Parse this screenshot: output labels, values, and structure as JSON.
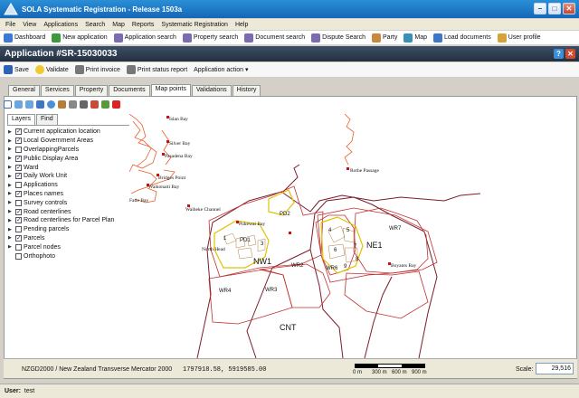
{
  "window": {
    "title": "SOLA Systematic Registration - Release 1503a"
  },
  "menu": [
    "File",
    "View",
    "Applications",
    "Search",
    "Map",
    "Reports",
    "Systematic Registration",
    "Help"
  ],
  "toolbar": {
    "items": [
      {
        "label": "Dashboard",
        "icon": "dashboard-icon",
        "color": "#3a7bd5"
      },
      {
        "label": "New application",
        "icon": "new-application-icon",
        "color": "#3c9a3c"
      },
      {
        "label": "Application search",
        "icon": "search-icon",
        "color": "#7b6bb0"
      },
      {
        "label": "Property search",
        "icon": "search-icon",
        "color": "#7b6bb0"
      },
      {
        "label": "Document search",
        "icon": "search-icon",
        "color": "#7b6bb0"
      },
      {
        "label": "Dispute Search",
        "icon": "search-icon",
        "color": "#7b6bb0"
      },
      {
        "label": "Party",
        "icon": "party-icon",
        "color": "#c9893a"
      },
      {
        "label": "Map",
        "icon": "map-icon",
        "color": "#3a8fb7"
      },
      {
        "label": "Load documents",
        "icon": "load-documents-icon",
        "color": "#3c78c9"
      },
      {
        "label": "User profile",
        "icon": "user-profile-icon",
        "color": "#d6a23a"
      }
    ]
  },
  "header": {
    "title": "Application #SR-15030033"
  },
  "actions": {
    "save": "Save",
    "validate": "Validate",
    "print_invoice": "Print invoice",
    "print_status": "Print status report",
    "app_action": "Application action"
  },
  "tabs": [
    "General",
    "Services",
    "Property",
    "Documents",
    "Map points",
    "Validations",
    "History"
  ],
  "active_tab": "Map points",
  "layer_tabs": [
    "Layers",
    "Find"
  ],
  "layers": [
    {
      "label": "Current application location",
      "checked": true,
      "expand": true
    },
    {
      "label": "Local Government Areas",
      "checked": true,
      "expand": true
    },
    {
      "label": "OverlappingParcels",
      "checked": false,
      "expand": true
    },
    {
      "label": "Public Display Area",
      "checked": true,
      "expand": true
    },
    {
      "label": "Ward",
      "checked": true,
      "expand": true
    },
    {
      "label": "Daily Work Unit",
      "checked": true,
      "expand": true
    },
    {
      "label": "Applications",
      "checked": false,
      "expand": true
    },
    {
      "label": "Places names",
      "checked": true,
      "expand": true
    },
    {
      "label": "Survey controls",
      "checked": false,
      "expand": true
    },
    {
      "label": "Road centerlines",
      "checked": true,
      "expand": true
    },
    {
      "label": "Road centerlines for Parcel Plan",
      "checked": true,
      "expand": true
    },
    {
      "label": "Pending parcels",
      "checked": false,
      "expand": true
    },
    {
      "label": "Parcels",
      "checked": true,
      "expand": true
    },
    {
      "label": "Parcel nodes",
      "checked": false,
      "expand": true
    },
    {
      "label": "Orthophoto",
      "checked": false,
      "expand": false
    }
  ],
  "map": {
    "places": [
      "Islan Bay",
      "Silver Bay",
      "Pasadena Bay",
      "Bridges Point",
      "Waikonaiti Bay",
      "Fatie Bay",
      "Waiheke Channel",
      "Putiki Bay",
      "North Head",
      "Rothe Passage",
      "Boyants Bay",
      "Pukewai Bay"
    ],
    "zones": [
      "NW1",
      "NE1",
      "CNT",
      "WR1",
      "WR2",
      "WR3",
      "WR4",
      "WR6",
      "WR7",
      "PD1",
      "PD2",
      "2",
      "3",
      "4",
      "5",
      "6",
      "7",
      "8",
      "9",
      "1"
    ]
  },
  "status": {
    "crs": "NZGD2000 / New Zealand Transverse Mercator 2000",
    "coords": "1797918.58, 5919585.00",
    "scale_label": "Scale:",
    "scale_value": "29,516",
    "scalebar_labels": [
      "0 m",
      "300 m",
      "600 m",
      "900 m"
    ]
  },
  "user": {
    "label": "User:",
    "name": "test"
  }
}
